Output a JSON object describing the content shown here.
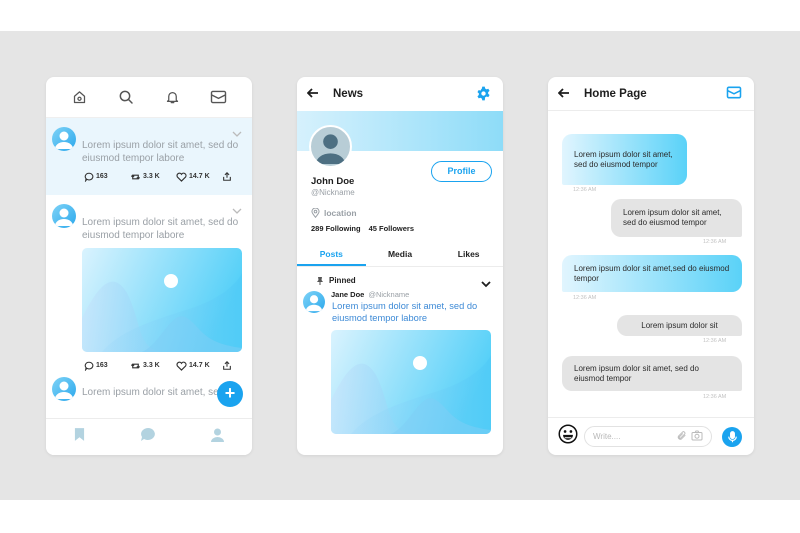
{
  "colors": {
    "accent": "#1aa3ef",
    "background_band": "#e5e5e5",
    "muted_text": "#9aa0a6",
    "incoming_bubble_start": "#e1f5fe",
    "incoming_bubble_end": "#5ad2f8",
    "outgoing_bubble": "#e4e4e4"
  },
  "feed": {
    "top_nav": [
      {
        "icon": "home-icon"
      },
      {
        "icon": "search-icon"
      },
      {
        "icon": "bell-icon"
      },
      {
        "icon": "mail-icon"
      }
    ],
    "tweets": [
      {
        "text": "Lorem ipsum dolor sit amet, sed do eiusmod tempor labore",
        "replies": "163",
        "retweets": "3.3 K",
        "likes": "14.7 K",
        "highlighted": true,
        "has_image": false
      },
      {
        "text": "Lorem ipsum dolor sit amet, sed do eiusmod tempor labore",
        "replies": "163",
        "retweets": "3.3 K",
        "likes": "14.7 K",
        "highlighted": false,
        "has_image": true
      },
      {
        "text": "Lorem ipsum dolor sit amet, sed",
        "highlighted": false,
        "has_image": false
      }
    ],
    "fab_label": "+",
    "bottom_nav": [
      {
        "icon": "bookmark-icon"
      },
      {
        "icon": "chat-bubble-icon"
      },
      {
        "icon": "user-icon"
      }
    ]
  },
  "profile": {
    "header_title": "News",
    "name": "John Doe",
    "nickname": "@Nickname",
    "profile_button": "Profile",
    "location": "location",
    "following": "289 Following",
    "followers": "45 Followers",
    "tabs": [
      {
        "label": "Posts",
        "active": true
      },
      {
        "label": "Media",
        "active": false
      },
      {
        "label": "Likes",
        "active": false
      }
    ],
    "pinned_label": "Pinned",
    "pinned_post": {
      "author": "Jane Doe",
      "handle": "@Nickname",
      "text": "Lorem ipsum dolor sit amet, sed do eiusmod tempor labore"
    }
  },
  "chat": {
    "header_title": "Home Page",
    "messages": [
      {
        "direction": "in",
        "text": "Lorem ipsum dolor sit amet, sed do eiusmod tempor",
        "time": "12:36 AM"
      },
      {
        "direction": "out",
        "text": "Lorem ipsum dolor sit amet, sed do eiusmod tempor",
        "time": "12:36 AM"
      },
      {
        "direction": "in",
        "text": "Lorem ipsum dolor sit amet,sed do eiusmod tempor",
        "time": "12:36 AM"
      },
      {
        "direction": "out",
        "text": "Lorem ipsum dolor sit",
        "time": "12:36 AM"
      },
      {
        "direction": "out",
        "text": "Lorem ipsum dolor sit amet, sed do eiusmod tempor",
        "time": "12:36 AM"
      }
    ],
    "composer_placeholder": "Write...."
  }
}
